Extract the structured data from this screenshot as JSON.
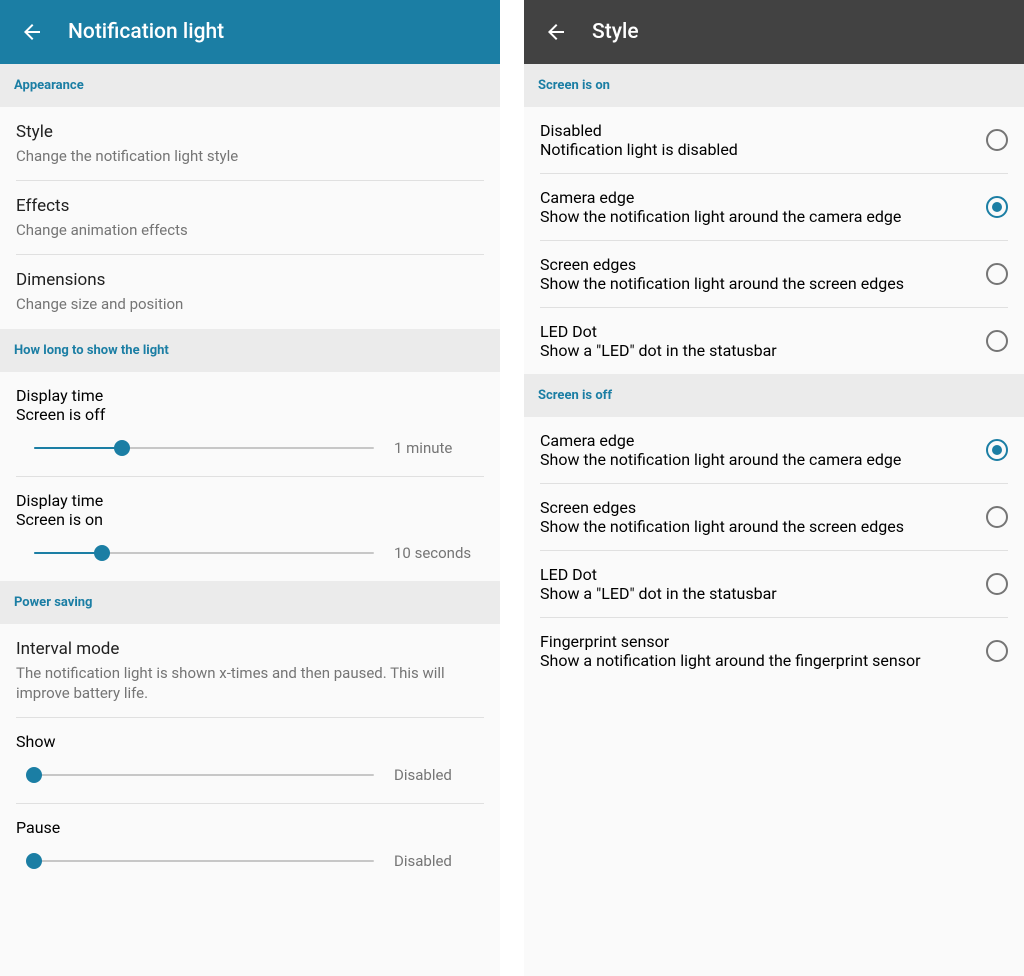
{
  "colors": {
    "accent": "#1b7ea4",
    "appbar_right": "#424242"
  },
  "left": {
    "appbar_title": "Notification light",
    "sections": {
      "appearance": {
        "header": "Appearance",
        "style": {
          "title": "Style",
          "sub": "Change the notification light style"
        },
        "effects": {
          "title": "Effects",
          "sub": "Change animation effects"
        },
        "dimensions": {
          "title": "Dimensions",
          "sub": "Change size and position"
        }
      },
      "duration": {
        "header": "How long to show the light",
        "display_off": {
          "title": "Display time",
          "sub": "Screen is off",
          "value_label": "1 minute",
          "slider_percent": 26
        },
        "display_on": {
          "title": "Display time",
          "sub": "Screen is on",
          "value_label": "10 seconds",
          "slider_percent": 20
        }
      },
      "power": {
        "header": "Power saving",
        "interval": {
          "title": "Interval mode",
          "sub": "The notification light is shown x-times and then paused. This will improve battery life."
        },
        "show": {
          "title": "Show",
          "value_label": "Disabled",
          "slider_percent": 0
        },
        "pause": {
          "title": "Pause",
          "value_label": "Disabled",
          "slider_percent": 0
        }
      }
    }
  },
  "right": {
    "appbar_title": "Style",
    "groups": {
      "screen_on": {
        "header": "Screen is on",
        "options": [
          {
            "title": "Disabled",
            "sub": "Notification light is disabled",
            "selected": false
          },
          {
            "title": "Camera edge",
            "sub": "Show the notification light around the camera edge",
            "selected": true
          },
          {
            "title": "Screen edges",
            "sub": "Show the notification light around the screen edges",
            "selected": false
          },
          {
            "title": "LED Dot",
            "sub": "Show a \"LED\" dot in the statusbar",
            "selected": false
          }
        ]
      },
      "screen_off": {
        "header": "Screen is off",
        "options": [
          {
            "title": "Camera edge",
            "sub": "Show the notification light around the camera edge",
            "selected": true
          },
          {
            "title": "Screen edges",
            "sub": "Show the notification light around the screen edges",
            "selected": false
          },
          {
            "title": "LED Dot",
            "sub": "Show a \"LED\" dot in the statusbar",
            "selected": false
          },
          {
            "title": "Fingerprint sensor",
            "sub": "Show a notification light around the fingerprint sensor",
            "selected": false
          }
        ]
      }
    }
  }
}
